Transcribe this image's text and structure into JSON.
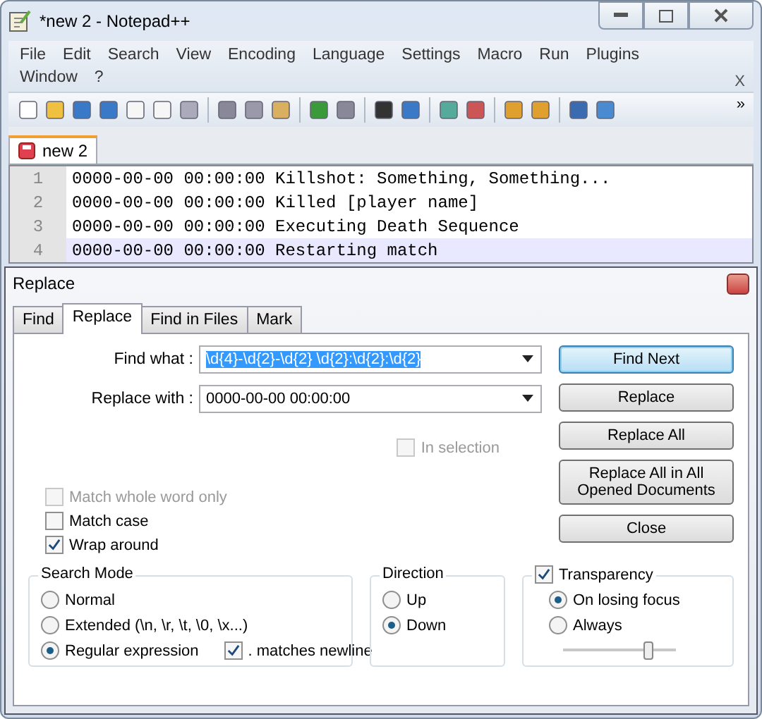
{
  "window": {
    "title": "*new  2 - Notepad++"
  },
  "menu": {
    "items": [
      "File",
      "Edit",
      "Search",
      "View",
      "Encoding",
      "Language",
      "Settings",
      "Macro",
      "Run",
      "Plugins",
      "Window",
      "?"
    ],
    "close": "X",
    "overflow": "»"
  },
  "doc_tabs": [
    {
      "label": "new  2",
      "selected": true
    }
  ],
  "editor": {
    "lines": [
      {
        "number": "1",
        "text": "0000-00-00 00:00:00 Killshot: Something, Something...",
        "selected": false
      },
      {
        "number": "2",
        "text": "0000-00-00 00:00:00 Killed [player name]",
        "selected": false
      },
      {
        "number": "3",
        "text": "0000-00-00 00:00:00 Executing Death Sequence",
        "selected": false
      },
      {
        "number": "4",
        "text": "0000-00-00 00:00:00 Restarting match",
        "selected": true
      }
    ]
  },
  "dialog": {
    "title": "Replace",
    "tabs": [
      {
        "label": "Find",
        "selected": false
      },
      {
        "label": "Replace",
        "selected": true
      },
      {
        "label": "Find in Files",
        "selected": false
      },
      {
        "label": "Mark",
        "selected": false
      }
    ],
    "fields": [
      {
        "label": "Find what :",
        "value": "\\d{4}-\\d{2}-\\d{2} \\d{2}:\\d{2}:\\d{2}",
        "selected": true
      },
      {
        "label": "Replace with :",
        "value": "0000-00-00 00:00:00",
        "selected": false
      }
    ],
    "in_selection": {
      "label": "In selection",
      "checked": false,
      "disabled": true
    },
    "buttons": [
      {
        "label": "Find Next",
        "focused": true
      },
      {
        "label": "Replace",
        "focused": false
      },
      {
        "label": "Replace All",
        "focused": false
      },
      {
        "label": "Replace All in All Opened Documents",
        "focused": false
      },
      {
        "label": "Close",
        "focused": false
      }
    ],
    "options": [
      {
        "label": "Match whole word only",
        "checked": false,
        "disabled": true
      },
      {
        "label": "Match case",
        "checked": false,
        "disabled": false
      },
      {
        "label": "Wrap around",
        "checked": true,
        "disabled": false
      }
    ],
    "search_mode": {
      "title": "Search Mode",
      "options": [
        {
          "label": "Normal",
          "selected": false
        },
        {
          "label": "Extended (\\n, \\r, \\t, \\0, \\x...)",
          "selected": false
        },
        {
          "label": "Regular expression",
          "selected": true
        }
      ],
      "dot_newline": {
        "label": ". matches newline",
        "checked": true
      }
    },
    "direction": {
      "title": "Direction",
      "options": [
        {
          "label": "Up",
          "selected": false
        },
        {
          "label": "Down",
          "selected": true
        }
      ]
    },
    "transparency": {
      "label": "Transparency",
      "checked": true,
      "options": [
        {
          "label": "On losing focus",
          "selected": true
        },
        {
          "label": "Always",
          "selected": false
        }
      ],
      "level": 0.75
    }
  }
}
